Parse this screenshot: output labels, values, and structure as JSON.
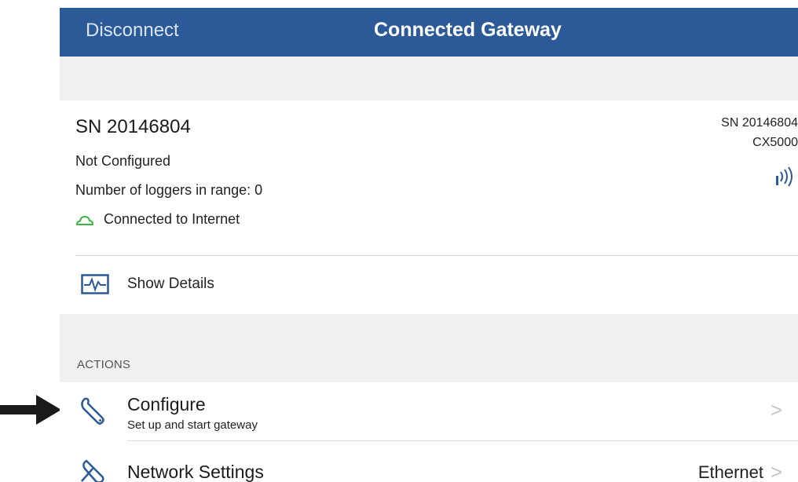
{
  "nav": {
    "back_label": "Disconnect",
    "title": "Connected Gateway"
  },
  "gateway": {
    "serial_title": "SN 20146804",
    "config_status": "Not Configured",
    "loggers_in_range": "Number of loggers in range: 0",
    "internet_status": "Connected to Internet",
    "serial_small": "SN 20146804",
    "model": "CX5000",
    "show_details_label": "Show Details"
  },
  "actions": {
    "section_label": "ACTIONS",
    "items": [
      {
        "title": "Configure",
        "subtitle": "Set up and start gateway",
        "value": "",
        "chevron": ">"
      },
      {
        "title": "Network Settings",
        "subtitle": "",
        "value": "Ethernet",
        "chevron": ">"
      }
    ]
  },
  "colors": {
    "nav_bar": "#2c5a98",
    "cloud_icon": "#3cb44a",
    "icon_blue": "#2c5a98",
    "background": "#f0f0f2"
  },
  "icons": {
    "internet": "cloud-icon",
    "details": "activity-monitor-icon",
    "configure": "wrench-icon",
    "network": "network-tools-icon",
    "signal": "wireless-signal-icon",
    "pointer": "arrow-right-icon"
  }
}
